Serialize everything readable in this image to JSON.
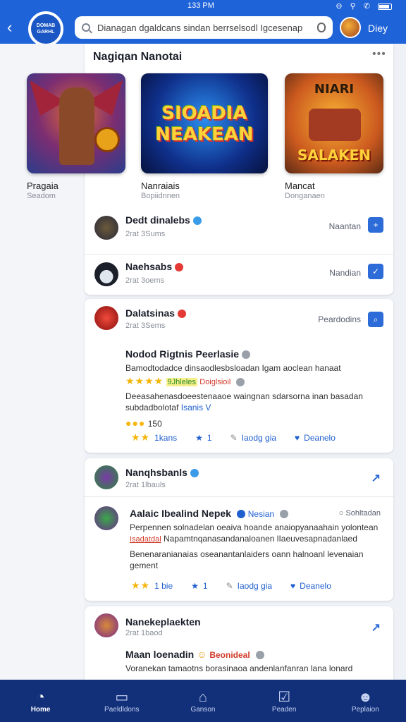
{
  "status": {
    "time": "133 PM"
  },
  "header": {
    "logo_line1": "DOMAB",
    "logo_line2": "GARHL",
    "search_value": "Dianagan dgaldcans sindan berrselsodl Igcesenap",
    "user_name": "Diey"
  },
  "featured": {
    "title": "Nagiqan Nanotai",
    "games": [
      {
        "name": "Pragaia",
        "sub": "Seadom"
      },
      {
        "name": "Nanraiais",
        "sub": "Bopiidnnen",
        "art": "SIOADIA NEAKEAN"
      },
      {
        "name": "Mancat",
        "sub": "Donganaen",
        "art_top": "NIARI",
        "art": "SALAKEN"
      }
    ]
  },
  "rows": [
    {
      "name": "Dedt dinalebs",
      "sub": "2rat 3Sums",
      "action": "Naantan",
      "icon": "plus-icon"
    },
    {
      "name": "Naehsabs",
      "sub": "2rat 3oems",
      "action": "Nandian",
      "icon": "check-icon"
    }
  ],
  "post1": {
    "author": "Dalatsinas",
    "sub": "2rat 3Sems",
    "action": "Peardodins",
    "title": "Nodod Rigtnis Peerlasie",
    "line1": "Bamodtodadce dinsaodlesbsloadan Igam aoclean hanaat",
    "rating_tag": "9Jhleles",
    "red_tag": "Doiglsioil",
    "line2": "Deeasahenasdoeestenaaoe waingnan sdarsorna inan basadan",
    "line3": "subdadbolotaf",
    "link": "Isanis V",
    "score": "150",
    "actions": [
      "1kans",
      "1",
      "Iaodg gia",
      "Deanelo"
    ]
  },
  "post2": {
    "author": "Nanqhsbanls",
    "sub": "2rat 1lbauls",
    "title": "Aalaic Ibealind Nepek",
    "tag": "Nesian",
    "status": "Sohltadan",
    "line1": "Perpennen solnadelan oeaiva hoande anaiopyanaahain yolontean",
    "line2_red": "Isadatdal",
    "line2": "Napamtnqanasandanaloanen lIaeuvesapnadanlaed",
    "line3": "Benenaranianaias oseanantanlaiders oann halnoanl levenaian",
    "line4": "gement",
    "actions": [
      "1 bie",
      "1",
      "Iaodg gia",
      "Deanelo"
    ]
  },
  "post3": {
    "author": "Nanekeplaekten",
    "sub": "2rat 1baod",
    "title": "Maan loenadin",
    "red_tag": "Beonideal",
    "line1": "Voranekan tamaotns borasinaoa andenlanfanran lana lonard"
  },
  "nav": [
    "Home",
    "Paeldldons",
    "Ganson",
    "Peaden",
    "Peplaion"
  ],
  "colors": {
    "primary": "#1f63d8",
    "nav_bg": "#12307a"
  }
}
